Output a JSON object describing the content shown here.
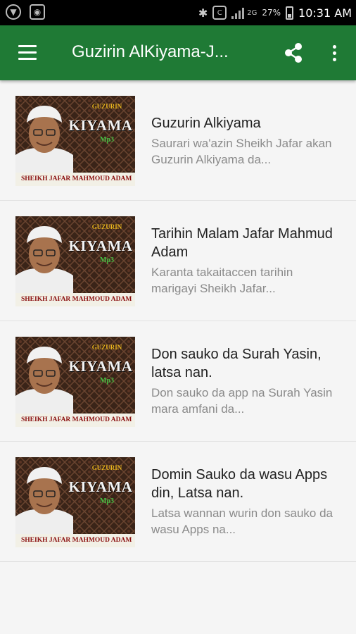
{
  "status_bar": {
    "battery": "27%",
    "time": "10:31 AM",
    "network": "2G",
    "icons": [
      "download-notification-icon",
      "screenshot-notification-icon",
      "bluetooth-icon",
      "call-forward-icon",
      "signal-icon",
      "battery-icon"
    ]
  },
  "app_bar": {
    "title": "Guzirin AlKiyama-J...",
    "color": "#1f7a35",
    "icons": [
      "menu-icon",
      "share-icon",
      "more-vert-icon"
    ]
  },
  "thumbnail": {
    "guzurin": "GUZURIN",
    "kiyama": "KIYAMA",
    "mp3": "Mp3",
    "caption": "SHEIKH JAFAR MAHMOUD ADAM"
  },
  "items": [
    {
      "title": "Guzurin Alkiyama",
      "description": "Saurari wa'azin Sheikh Jafar akan Guzurin Alkiyama da..."
    },
    {
      "title": "Tarihin Malam Jafar Mahmud Adam",
      "description": "Karanta takaitaccen tarihin marigayi Sheikh Jafar..."
    },
    {
      "title": "Don sauko da Surah Yasin, latsa nan.",
      "description": "Don sauko da app na Surah Yasin mara amfani da..."
    },
    {
      "title": "Domin Sauko da wasu Apps din, Latsa nan.",
      "description": "Latsa wannan wurin don sauko da wasu Apps na..."
    }
  ]
}
